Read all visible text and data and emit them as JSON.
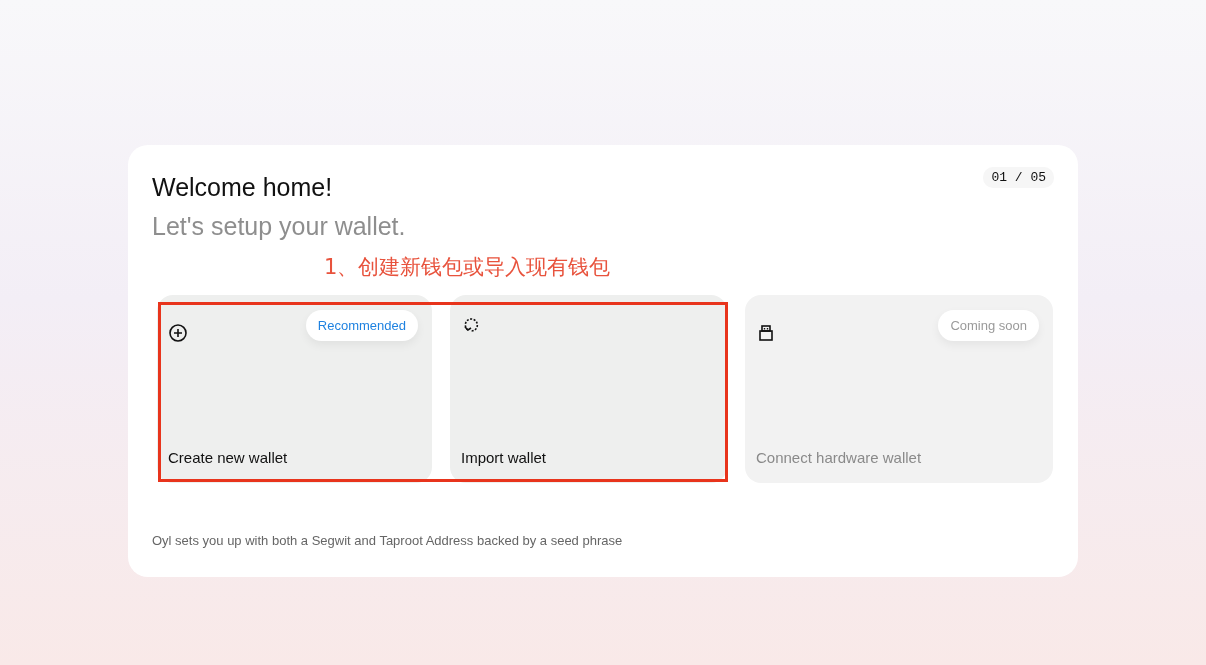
{
  "title": "Welcome home!",
  "subtitle": "Let's setup your wallet.",
  "step": "01 / 05",
  "annotation": {
    "text": "1、创建新钱包或导入现有钱包",
    "highlight": true
  },
  "options": [
    {
      "kind": "create",
      "label": "Create new wallet",
      "badge": "Recommended",
      "disabled": false
    },
    {
      "kind": "import",
      "label": "Import wallet",
      "disabled": false
    },
    {
      "kind": "hardware",
      "label": "Connect hardware wallet",
      "badge": "Coming soon",
      "disabled": true
    }
  ],
  "footnote": "Oyl sets you up with both a Segwit and Taproot Address backed by a seed phrase"
}
